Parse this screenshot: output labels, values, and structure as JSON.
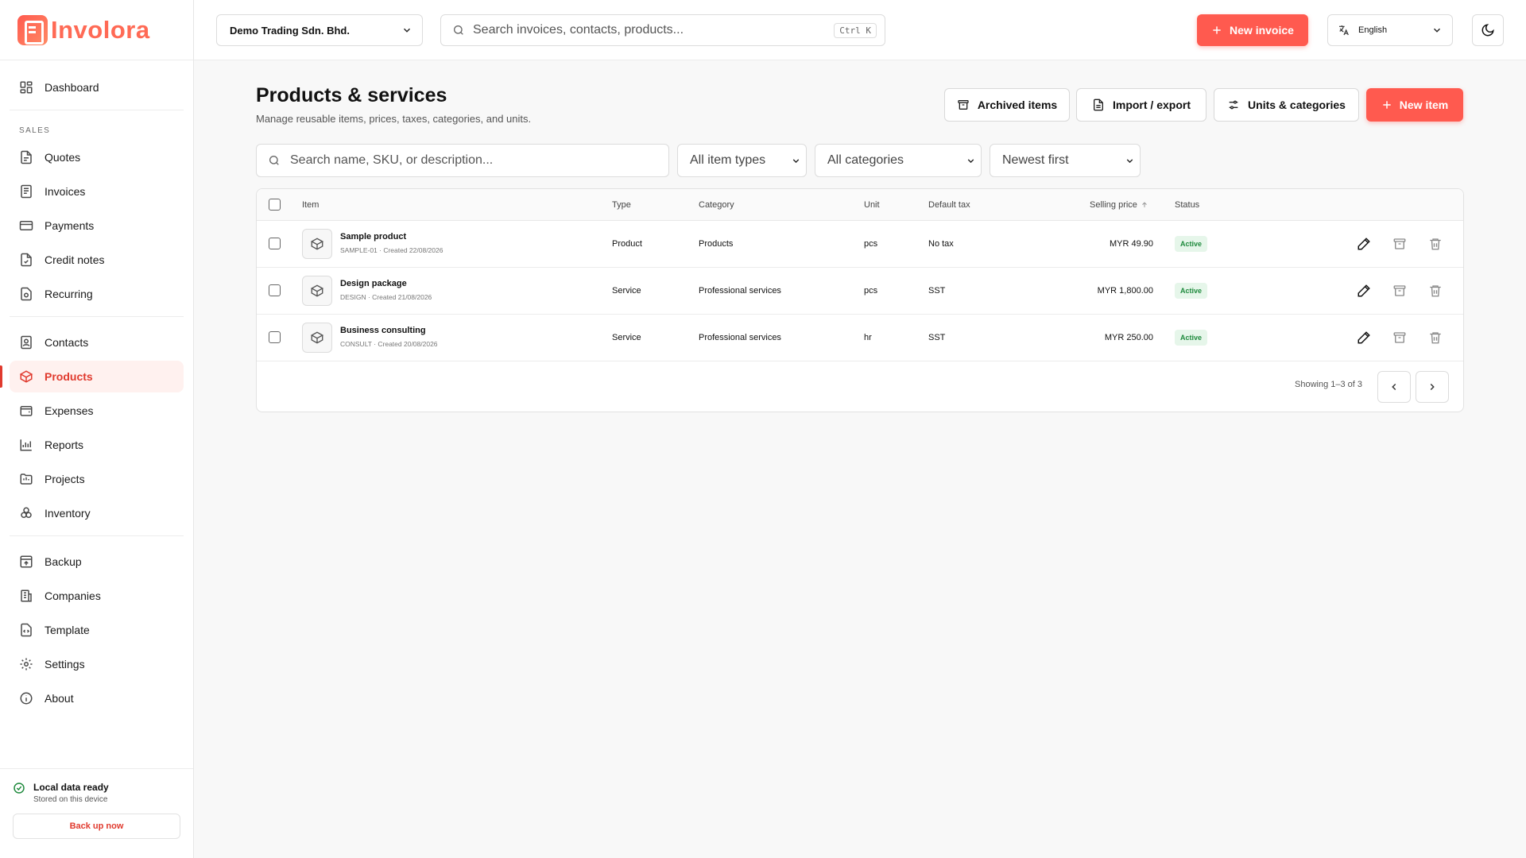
{
  "app": {
    "name": "Involora",
    "accent": "#ff5a4f",
    "active_color": "#e03a2e",
    "success": "#1f8a3d"
  },
  "sidebar": {
    "top_items": [
      {
        "label": "Dashboard",
        "icon": "dashboard-icon"
      }
    ],
    "sales_section": "SALES",
    "sales_items": [
      {
        "label": "Quotes",
        "icon": "quote-icon"
      },
      {
        "label": "Invoices",
        "icon": "invoice-icon"
      },
      {
        "label": "Payments",
        "icon": "card-icon"
      },
      {
        "label": "Credit notes",
        "icon": "credit-note-icon"
      },
      {
        "label": "Recurring",
        "icon": "recurring-icon"
      }
    ],
    "main_items": [
      {
        "label": "Contacts",
        "icon": "contacts-icon"
      },
      {
        "label": "Products",
        "icon": "box-icon",
        "active": true
      },
      {
        "label": "Expenses",
        "icon": "wallet-icon"
      },
      {
        "label": "Reports",
        "icon": "chart-icon"
      },
      {
        "label": "Projects",
        "icon": "folder-icon"
      },
      {
        "label": "Inventory",
        "icon": "boxes-icon"
      }
    ],
    "system_items": [
      {
        "label": "Backup",
        "icon": "backup-icon"
      },
      {
        "label": "Companies",
        "icon": "building-icon"
      },
      {
        "label": "Template",
        "icon": "template-icon"
      },
      {
        "label": "Settings",
        "icon": "gear-icon"
      },
      {
        "label": "About",
        "icon": "info-icon"
      }
    ],
    "footer": {
      "status_title": "Local data ready",
      "status_sub": "Stored on this device",
      "backup_label": "Back up now"
    }
  },
  "topbar": {
    "company": "Demo Trading Sdn. Bhd.",
    "search_placeholder": "Search invoices, contacts, products...",
    "search_shortcut": "Ctrl K",
    "new_invoice_label": "New invoice",
    "language": "English"
  },
  "page": {
    "title": "Products & services",
    "subtitle": "Manage reusable items, prices, taxes, categories, and units.",
    "actions": {
      "archived": "Archived items",
      "import_export": "Import / export",
      "units_categories": "Units & categories",
      "new_item": "New item"
    },
    "filters": {
      "search_placeholder": "Search name, SKU, or description...",
      "item_type": "All item types",
      "category": "All categories",
      "sort": "Newest first"
    }
  },
  "table": {
    "columns": {
      "item": "Item",
      "type": "Type",
      "category": "Category",
      "unit": "Unit",
      "default_tax": "Default tax",
      "selling_price": "Selling price",
      "status": "Status"
    },
    "rows": [
      {
        "name": "Sample product",
        "meta": "SAMPLE-01 · Created 22/08/2026",
        "type": "Product",
        "category": "Products",
        "unit": "pcs",
        "tax": "No tax",
        "price": "MYR 49.90",
        "status": "Active"
      },
      {
        "name": "Design package",
        "meta": "DESIGN · Created 21/08/2026",
        "type": "Service",
        "category": "Professional services",
        "unit": "pcs",
        "tax": "SST",
        "price": "MYR 1,800.00",
        "status": "Active"
      },
      {
        "name": "Business consulting",
        "meta": "CONSULT · Created 20/08/2026",
        "type": "Service",
        "category": "Professional services",
        "unit": "hr",
        "tax": "SST",
        "price": "MYR 250.00",
        "status": "Active"
      }
    ],
    "pagination": "Showing 1–3 of 3"
  }
}
